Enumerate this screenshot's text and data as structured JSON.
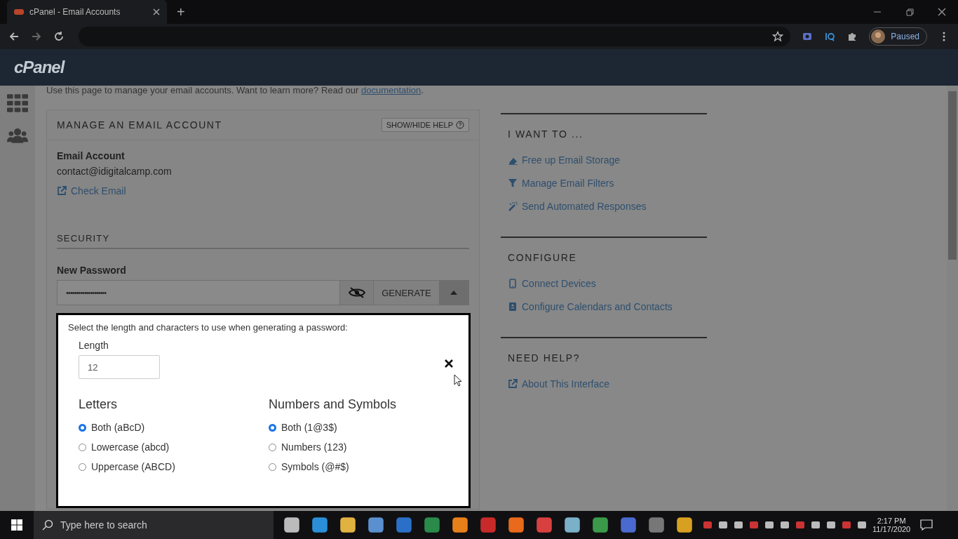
{
  "browser": {
    "tab_title": "cPanel - Email Accounts",
    "new_tab": "+",
    "profile": "Paused"
  },
  "header": {
    "logo": "cPanel"
  },
  "intro": {
    "text": "Use this page to manage your email accounts. Want to learn more? Read our",
    "link": "documentation",
    "end": "."
  },
  "manage_panel": {
    "title": "MANAGE AN EMAIL ACCOUNT",
    "help_button": "SHOW/HIDE HELP",
    "email_label": "Email Account",
    "email_value": "contact@idigitalcamp.com",
    "check_email_link": "Check Email",
    "security_heading": "SECURITY",
    "password_label": "New Password",
    "password_value": "••••••••••••••••••••",
    "generate_button": "GENERATE"
  },
  "sections": [
    {
      "heading": "I WANT TO ...",
      "links": [
        {
          "label": "Free up Email Storage",
          "kind": "eraser"
        },
        {
          "label": "Manage Email Filters",
          "kind": "filter"
        },
        {
          "label": "Send Automated Responses",
          "kind": "wand"
        }
      ]
    },
    {
      "heading": "CONFIGURE",
      "links": [
        {
          "label": "Connect Devices",
          "kind": "phone"
        },
        {
          "label": "Configure Calendars and Contacts",
          "kind": "book"
        }
      ]
    },
    {
      "heading": "NEED HELP?",
      "links": [
        {
          "label": "About This Interface",
          "kind": "external"
        }
      ]
    }
  ],
  "popup": {
    "instructions": "Select the length and characters to use when generating a password:",
    "length_label": "Length",
    "length_value": "12",
    "groups": [
      {
        "heading": "Letters",
        "options": [
          {
            "label": "Both (aBcD)",
            "selected": true
          },
          {
            "label": "Lowercase (abcd)",
            "selected": false
          },
          {
            "label": "Uppercase (ABCD)",
            "selected": false
          }
        ]
      },
      {
        "heading": "Numbers and Symbols",
        "options": [
          {
            "label": "Both (1@3$)",
            "selected": true
          },
          {
            "label": "Numbers (123)",
            "selected": false
          },
          {
            "label": "Symbols (@#$)",
            "selected": false
          }
        ]
      }
    ]
  },
  "taskbar": {
    "search_placeholder": "Type here to search",
    "time": "2:17 PM",
    "date": "11/17/2020"
  }
}
